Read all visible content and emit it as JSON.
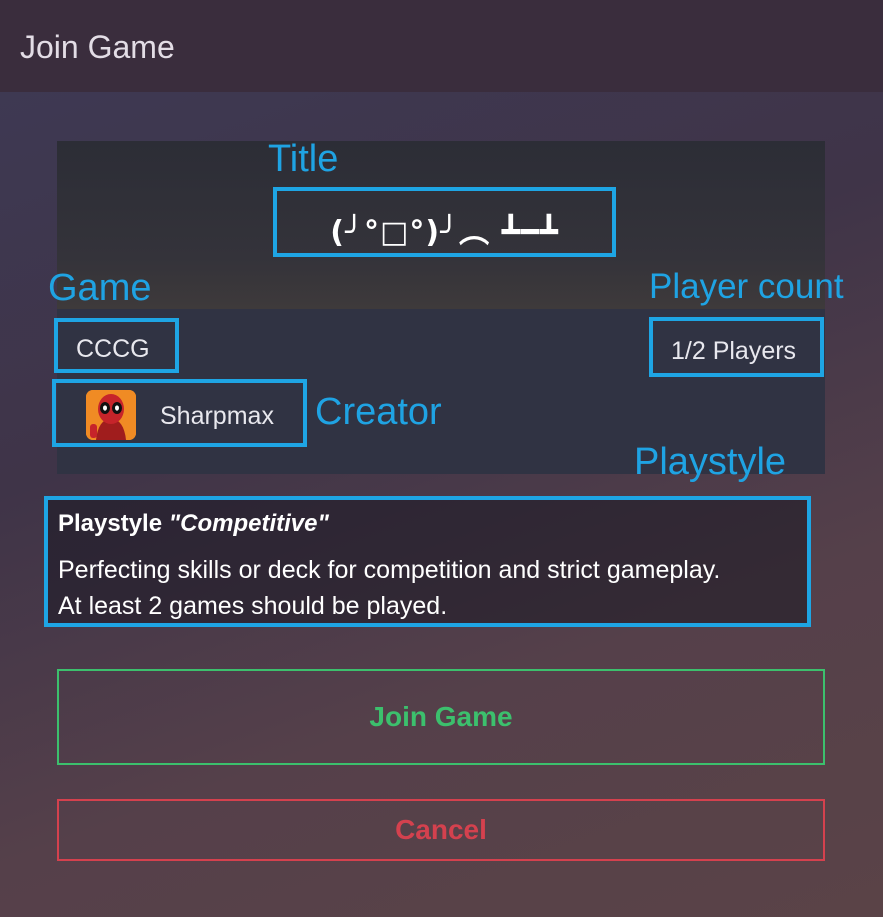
{
  "header": {
    "title": "Join Game"
  },
  "annotations": {
    "title": "Title",
    "game": "Game",
    "player_count": "Player count",
    "creator": "Creator",
    "playstyle": "Playstyle"
  },
  "game": {
    "title": "(╯°□°)╯︵ ┻━┻",
    "name": "CCCG",
    "player_count": "1/2 Players",
    "creator": "Sharpmax",
    "playstyle_label": "Playstyle",
    "playstyle_value": "\"Competitive\"",
    "playstyle_desc_1": "Perfecting skills or deck for competition and strict gameplay.",
    "playstyle_desc_2": "At least 2 games should be played."
  },
  "buttons": {
    "join": "Join Game",
    "cancel": "Cancel"
  },
  "colors": {
    "annotation": "#1ea5e4",
    "join": "#3cc06d",
    "cancel": "#d4414e"
  },
  "icons": {
    "avatar": "deadpool-avatar"
  }
}
